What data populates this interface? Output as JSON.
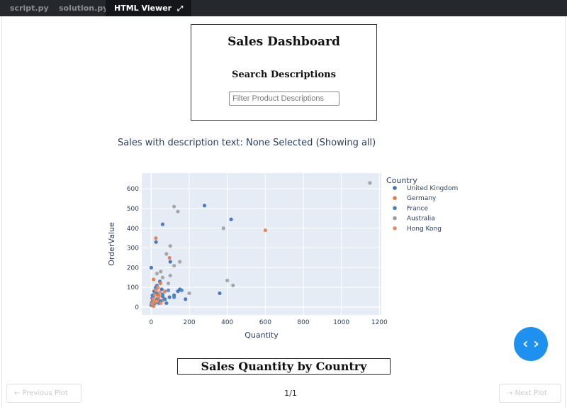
{
  "tabs": [
    {
      "label": "script.py"
    },
    {
      "label": "solution.py"
    },
    {
      "label": "HTML Viewer"
    }
  ],
  "icons": {
    "expand": "expand-icon",
    "code_toggle": "code-toggle-icon"
  },
  "dashboard": {
    "title": "Sales Dashboard",
    "search_title": "Search Descriptions",
    "search_placeholder": "Filter Product Descriptions",
    "status_text": "Sales with description text: None Selected (Showing all)"
  },
  "chart_data": {
    "type": "scatter",
    "xlabel": "Quantity",
    "ylabel": "OrderValue",
    "xlim": [
      -50,
      1210
    ],
    "ylim": [
      -40,
      680
    ],
    "xticks": [
      0,
      200,
      400,
      600,
      800,
      1000,
      1200
    ],
    "yticks": [
      0,
      100,
      200,
      300,
      400,
      500,
      600
    ],
    "legend_title": "Country",
    "legend_position": "right",
    "series": [
      {
        "name": "United Kingdom",
        "color": "#3d6fb6",
        "points": [
          [
            0,
            10
          ],
          [
            2,
            20
          ],
          [
            5,
            45
          ],
          [
            8,
            30
          ],
          [
            10,
            60
          ],
          [
            12,
            15
          ],
          [
            15,
            80
          ],
          [
            20,
            25
          ],
          [
            24,
            100
          ],
          [
            30,
            40
          ],
          [
            35,
            65
          ],
          [
            40,
            20
          ],
          [
            48,
            30
          ],
          [
            55,
            90
          ],
          [
            60,
            55
          ],
          [
            70,
            40
          ],
          [
            80,
            20
          ],
          [
            96,
            50
          ],
          [
            120,
            60
          ],
          [
            140,
            80
          ],
          [
            150,
            90
          ],
          [
            0,
            200
          ],
          [
            25,
            330
          ],
          [
            60,
            420
          ],
          [
            280,
            515
          ],
          [
            420,
            445
          ],
          [
            360,
            70
          ],
          [
            100,
            230
          ],
          [
            180,
            40
          ],
          [
            45,
            130
          ]
        ]
      },
      {
        "name": "Germany",
        "color": "#e07b4a",
        "points": [
          [
            2,
            15
          ],
          [
            6,
            30
          ],
          [
            10,
            50
          ],
          [
            12,
            140
          ],
          [
            18,
            25
          ],
          [
            22,
            70
          ],
          [
            30,
            95
          ],
          [
            36,
            40
          ],
          [
            48,
            120
          ],
          [
            60,
            35
          ],
          [
            72,
            80
          ],
          [
            24,
            350
          ],
          [
            96,
            250
          ],
          [
            600,
            390
          ],
          [
            12,
            5
          ],
          [
            40,
            60
          ]
        ]
      },
      {
        "name": "France",
        "color": "#3d87c8",
        "points": [
          [
            3,
            12
          ],
          [
            8,
            35
          ],
          [
            12,
            55
          ],
          [
            20,
            20
          ],
          [
            25,
            75
          ],
          [
            30,
            110
          ],
          [
            36,
            45
          ],
          [
            50,
            30
          ],
          [
            60,
            65
          ],
          [
            72,
            40
          ],
          [
            90,
            85
          ],
          [
            120,
            50
          ],
          [
            160,
            85
          ],
          [
            24,
            95
          ],
          [
            6,
            60
          ]
        ]
      },
      {
        "name": "Australia",
        "color": "#9e9e9e",
        "points": [
          [
            1150,
            630
          ],
          [
            120,
            510
          ],
          [
            140,
            485
          ],
          [
            380,
            400
          ],
          [
            100,
            310
          ],
          [
            80,
            270
          ],
          [
            50,
            180
          ],
          [
            150,
            230
          ],
          [
            120,
            210
          ],
          [
            200,
            70
          ],
          [
            400,
            135
          ],
          [
            430,
            110
          ],
          [
            60,
            150
          ],
          [
            30,
            170
          ],
          [
            100,
            160
          ],
          [
            90,
            120
          ]
        ]
      },
      {
        "name": "Hong Kong",
        "color": "#f08a5d",
        "points": [
          [
            10,
            40
          ],
          [
            15,
            25
          ],
          [
            20,
            60
          ],
          [
            30,
            30
          ],
          [
            40,
            50
          ],
          [
            50,
            20
          ],
          [
            45,
            75
          ],
          [
            35,
            100
          ],
          [
            25,
            85
          ],
          [
            5,
            15
          ]
        ]
      }
    ]
  },
  "bottom": {
    "title": "Sales Quantity by Country",
    "prev_label": "← Previous Plot",
    "next_label": "⇢ Next Plot",
    "pager": "1/1"
  }
}
